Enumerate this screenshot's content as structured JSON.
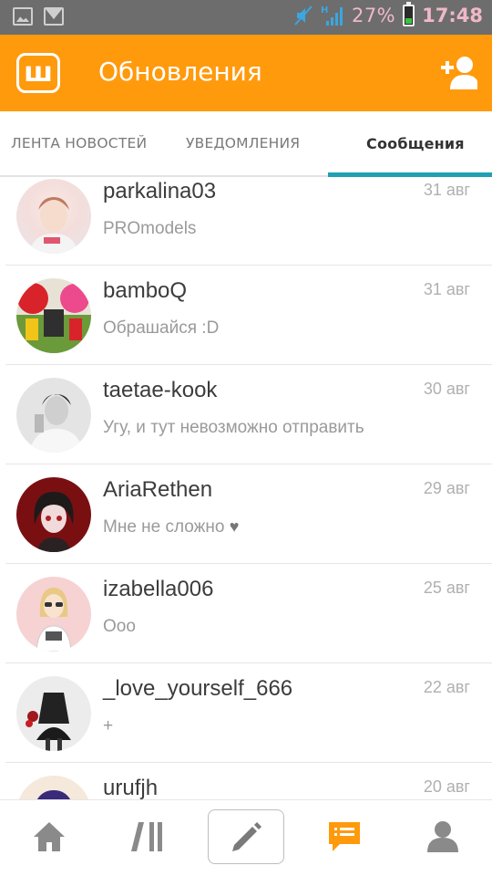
{
  "status_bar": {
    "icons_left": [
      "gallery-icon",
      "mail-icon"
    ],
    "battery_percent": "27%",
    "time": "17:48"
  },
  "app_bar": {
    "logo_letter": "ш",
    "title": "Обновления",
    "action_icon": "add-user-icon"
  },
  "tabs": [
    {
      "label": "ЛЕНТА НОВОСТЕЙ",
      "active": false
    },
    {
      "label": "УВЕДОМЛЕНИЯ",
      "active": false
    },
    {
      "label": "Сообщения",
      "active": true
    }
  ],
  "conversations": [
    {
      "username": "parkalina03",
      "date": "31 авг",
      "message": "PROmodels"
    },
    {
      "username": "bamboQ",
      "date": "31 авг",
      "message": "Обрашайся :D"
    },
    {
      "username": "taetae-kook",
      "date": "30 авг",
      "message": "Угу, и тут невозможно отправить"
    },
    {
      "username": "AriaRethen",
      "date": "29 авг",
      "message": "Мне не сложно",
      "emoji": "♥"
    },
    {
      "username": "izabella006",
      "date": "25 авг",
      "message": "Ооо"
    },
    {
      "username": "_love_yourself_666",
      "date": "22 авг",
      "message": "+"
    },
    {
      "username": "urufjh",
      "date": "20 авг",
      "message": ""
    }
  ],
  "bottom_nav": [
    {
      "icon": "home-icon",
      "active": false
    },
    {
      "icon": "feed-icon",
      "active": false
    },
    {
      "icon": "pencil-icon",
      "active": false
    },
    {
      "icon": "messages-icon",
      "active": true
    },
    {
      "icon": "profile-icon",
      "active": false
    }
  ],
  "colors": {
    "accent": "#ff9a0d",
    "tab_indicator": "#1fa0b3",
    "nav_icon": "#8a8a8a",
    "nav_icon_active": "#ff9a0d"
  }
}
